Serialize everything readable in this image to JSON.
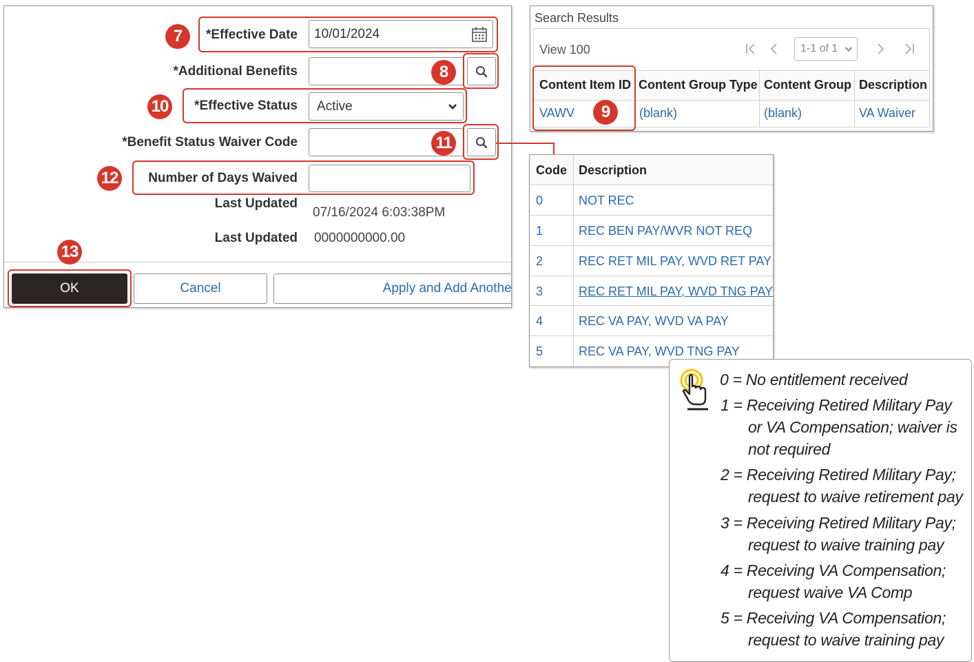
{
  "form": {
    "effective_date_label": "*Effective Date",
    "effective_date_value": "10/01/2024",
    "additional_benefits_label": "*Additional Benefits",
    "additional_benefits_value": "",
    "effective_status_label": "*Effective Status",
    "effective_status_value": "Active",
    "waiver_code_label": "*Benefit Status Waiver Code",
    "waiver_code_value": "",
    "days_waived_label": "Number of Days Waived",
    "days_waived_value": "",
    "last_updated_label_1": "Last Updated",
    "last_updated_value_1": "07/16/2024  6:03:38PM",
    "last_updated_label_2": "Last Updated",
    "last_updated_value_2": "0000000000.00"
  },
  "buttons": {
    "ok": "OK",
    "cancel": "Cancel",
    "apply_add": "Apply and Add Another"
  },
  "callouts": {
    "b7": "7",
    "b8": "8",
    "b9": "9",
    "b10": "10",
    "b11": "11",
    "b12": "12",
    "b13": "13"
  },
  "search_results": {
    "title": "Search Results",
    "view_label": "View 100",
    "pager_value": "1-1 of 1",
    "columns": [
      "Content Item ID",
      "Content Group Type",
      "Content Group",
      "Description"
    ],
    "row": [
      "VAWV",
      "(blank)",
      "(blank)",
      "VA Waiver"
    ]
  },
  "code_lookup": {
    "columns": [
      "Code",
      "Description"
    ],
    "rows": [
      {
        "code": "0",
        "desc": "NOT REC"
      },
      {
        "code": "1",
        "desc": "REC BEN PAY/WVR NOT REQ"
      },
      {
        "code": "2",
        "desc": "REC RET MIL PAY, WVD RET PAY"
      },
      {
        "code": "3",
        "desc": "REC RET MIL PAY, WVD TNG PAY"
      },
      {
        "code": "4",
        "desc": "REC VA PAY, WVD VA PAY"
      },
      {
        "code": "5",
        "desc": "REC VA PAY, WVD TNG PAY"
      }
    ]
  },
  "note": {
    "lines": [
      "0 = No entitlement received",
      "1 = Receiving Retired Military Pay",
      "or VA Compensation; waiver is",
      "not required",
      "2 = Receiving Retired Military Pay;",
      "request to waive retirement pay",
      "3 = Receiving Retired Military Pay;",
      "request to waive training pay",
      "4 = Receiving VA Compensation;",
      "request waive VA Comp",
      "5 = Receiving VA Compensation;",
      "request to waive training pay"
    ]
  },
  "colors": {
    "callout_red": "#d7362b",
    "link_blue": "#2a6bb0",
    "ok_button": "#2b2624",
    "tip_icon_yellow": "#f5c400"
  },
  "icons": [
    "calendar-icon",
    "search-icon",
    "chevron-down-icon",
    "first-page-icon",
    "prev-page-icon",
    "next-page-icon",
    "last-page-icon",
    "pointer-hand-icon"
  ]
}
